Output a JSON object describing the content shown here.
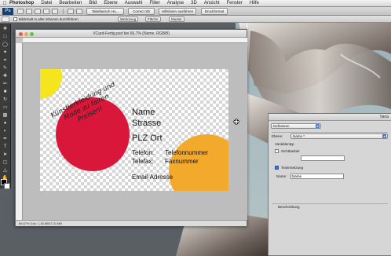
{
  "menubar": {
    "app": "Photoshop",
    "items": [
      "Datei",
      "Bearbeiten",
      "Bild",
      "Ebene",
      "Auswahl",
      "Filter",
      "Analyse",
      "3D",
      "Ansicht",
      "Fenster",
      "Hilfe"
    ]
  },
  "apptoolbar": {
    "app_icon": "Ps",
    "buttons": [
      "Tabellarisch Hu...",
      "Correct 3D",
      "Hilfslinien ausführen",
      "Druckformat"
    ]
  },
  "options": {
    "label": "Bildinhalt in allen Ebenen durchführen",
    "buttons": [
      "Werkzeug",
      "Fläche",
      "Muster"
    ]
  },
  "document": {
    "title": "VCard-Fertig.psd bei 66,7% (Name, RGB/8)",
    "status": "66,67%   Dok: 1,45 MB/7,00 MB",
    "card": {
      "name": "Name",
      "street": "Strasse",
      "city": "PLZ Ort",
      "phone_label": "Telefon:",
      "phone_value": "Telefonnummer",
      "fax_label": "Telefax:",
      "fax_value": "Faxnummer",
      "email": "Email-Adresse",
      "slogan": "Künstlerkleidung und Mode zu fairen Preisen!"
    },
    "colors": {
      "yellow": "#f5e51e",
      "red": "#d8173a",
      "orange": "#f3a92b"
    }
  },
  "panel": {
    "title": "Varia",
    "define_select": "Definieren",
    "layer_label": "Ebene:",
    "layer_value": "Name *",
    "group_label": "Variablentyp",
    "visibility_label": "Sichtbarkeit",
    "visibility_checked": false,
    "text_replace_label": "Textersetzung",
    "text_replace_checked": true,
    "name_label": "Name:",
    "name_value": "Name",
    "description_label": "Beschreibung"
  }
}
